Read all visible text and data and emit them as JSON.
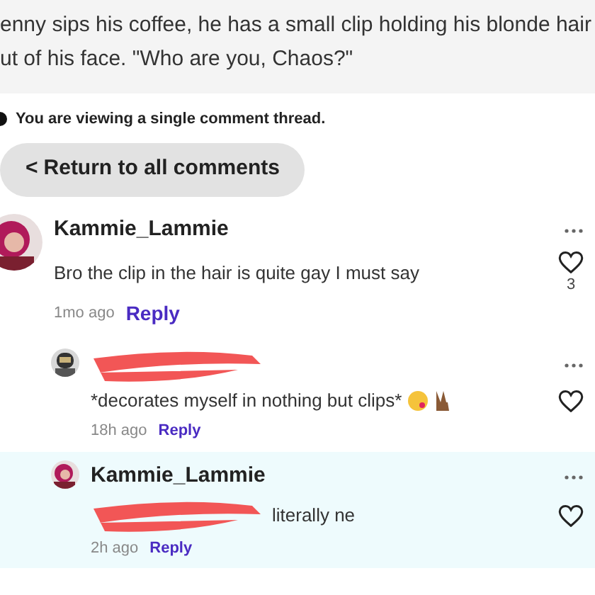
{
  "story_excerpt": [
    "enny sips his coffee, he has a small clip holding his blonde hair",
    "ut of his face. \"Who are you, Chaos?\""
  ],
  "thread_notice": "You are viewing a single comment thread.",
  "return_button": {
    "icon": "<",
    "label": "Return to all comments"
  },
  "comments": [
    {
      "kind": "top",
      "author": "Kammie_Lammie",
      "author_redacted": false,
      "text": "Bro the clip in the hair is quite gay I must say",
      "text_redacted": false,
      "emojis": false,
      "time": "1mo ago",
      "reply": "Reply",
      "likes": "3",
      "highlighted": false
    },
    {
      "kind": "reply",
      "author_redacted": true,
      "text": "*decorates myself in nothing but clips*",
      "text_redacted": false,
      "emojis": true,
      "time": "18h ago",
      "reply": "Reply",
      "highlighted": false
    },
    {
      "kind": "reply",
      "author": "Kammie_Lammie",
      "author_redacted": false,
      "text": "literally ne",
      "text_redacted": true,
      "emojis": false,
      "time": "2h ago",
      "reply": "Reply",
      "highlighted": true
    }
  ]
}
